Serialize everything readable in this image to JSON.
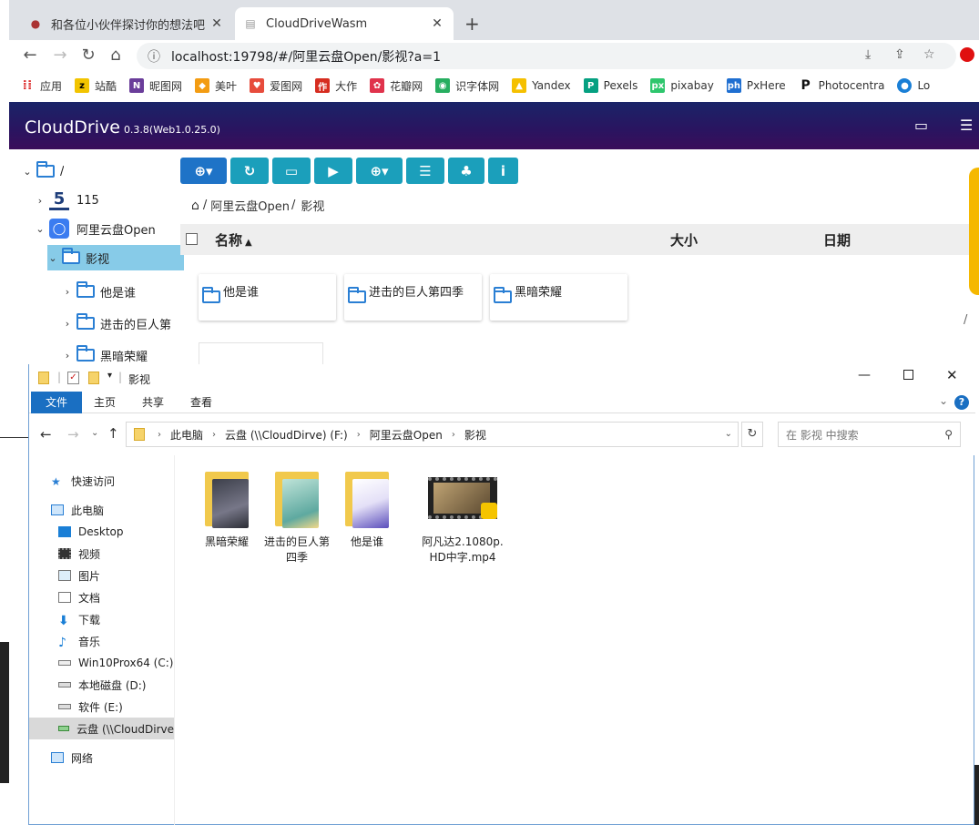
{
  "browser": {
    "tabs": [
      {
        "title": "和各位小伙伴探讨你的想法吧 | 爱",
        "active": false
      },
      {
        "title": "CloudDriveWasm",
        "active": true
      }
    ],
    "url": "localhost:19798/#/阿里云盘Open/影视?a=1",
    "bookmarks": [
      "应用",
      "站酷",
      "昵图网",
      "美叶",
      "爱图网",
      "大作",
      "花瓣网",
      "识字体网",
      "Yandex",
      "Pexels",
      "pixabay",
      "PxHere",
      "Photocentra",
      "Lo"
    ]
  },
  "app": {
    "brand": "CloudDrive",
    "version": "0.3.8(Web1.0.25.0)",
    "tree": [
      {
        "label": "/"
      },
      {
        "label": "115"
      },
      {
        "label": "阿里云盘Open"
      },
      {
        "label": "影视",
        "selected": true
      },
      {
        "label": "他是谁"
      },
      {
        "label": "进击的巨人第"
      },
      {
        "label": "黑暗荣耀"
      }
    ],
    "breadcrumb": [
      "阿里云盘Open",
      "影视"
    ],
    "columns": {
      "name": "名称",
      "size": "大小",
      "date": "日期"
    },
    "folders": [
      "他是谁",
      "进击的巨人第四季",
      "黑暗荣耀"
    ]
  },
  "explorer": {
    "title": "影视",
    "ribbon_tabs": [
      "文件",
      "主页",
      "共享",
      "查看"
    ],
    "path": [
      "此电脑",
      "云盘 (\\\\CloudDirve) (F:)",
      "阿里云盘Open",
      "影视"
    ],
    "search_placeholder": "在 影视 中搜索",
    "nav": [
      {
        "label": "快速访问"
      },
      {
        "label": "此电脑"
      },
      {
        "label": "Desktop"
      },
      {
        "label": "视频"
      },
      {
        "label": "图片"
      },
      {
        "label": "文档"
      },
      {
        "label": "下载"
      },
      {
        "label": "音乐"
      },
      {
        "label": "Win10Prox64 (C:)"
      },
      {
        "label": "本地磁盘 (D:)"
      },
      {
        "label": "软件 (E:)"
      },
      {
        "label": "云盘 (\\\\CloudDirve",
        "selected": true
      },
      {
        "label": "网络"
      }
    ],
    "items": [
      {
        "name": "黑暗荣耀"
      },
      {
        "name": "进击的巨人第四季"
      },
      {
        "name": "他是谁"
      },
      {
        "name": "阿凡达2.1080p.HD中字.mp4"
      }
    ],
    "colors": {
      "ribbon_file": "#1a6fc2",
      "selection": "#cce8ff"
    }
  },
  "colors": {
    "navbar": "#2a1460",
    "toolbar_blue": "#1e73c7",
    "toolbar_teal": "#1b9fbb",
    "tree_selected": "#87cbe8"
  }
}
